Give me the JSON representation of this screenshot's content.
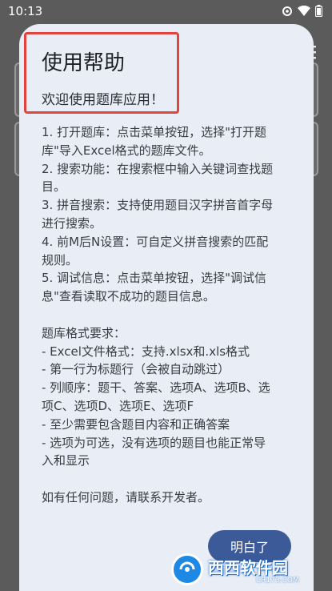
{
  "status_bar": {
    "time": "10:13",
    "icons": [
      "gear-icon",
      "wifi-icon",
      "battery-icon"
    ]
  },
  "dialog": {
    "title": "使用帮助",
    "subtitle": "欢迎使用题库应用！",
    "lines": [
      "1. 打开题库：点击菜单按钮，选择\"打开题",
      "库\"导入Excel格式的题库文件。",
      "2. 搜索功能：在搜索框中输入关键词查找题",
      "目。",
      "3. 拼音搜索：支持使用题目汉字拼音首字母",
      "进行搜索。",
      "4. 前M后N设置：可自定义拼音搜索的匹配",
      "规则。",
      "5. 调试信息：点击菜单按钮，选择\"调试信",
      "息\"查看读取不成功的题目信息。",
      "",
      "题库格式要求：",
      "- Excel文件格式：支持.xlsx和.xls格式",
      "- 第一行为标题行（会被自动跳过）",
      "- 列顺序：题干、答案、选项A、选项B、选",
      "项C、选项D、选项E、选项F",
      "- 至少需要包含题目内容和正确答案",
      "- 选项为可选，没有选项的题目也能正常导",
      "入和显示",
      "",
      "如有任何问题，请联系开发者。"
    ],
    "confirm_label": "明白了"
  },
  "watermark": {
    "main": "西西软件园",
    "sub": "CR173.COM"
  },
  "colors": {
    "dialog_bg": "#e9edf6",
    "highlight_box": "#e0443c",
    "button_bg": "#3c5a97",
    "scrim": "#5b5b5b"
  }
}
